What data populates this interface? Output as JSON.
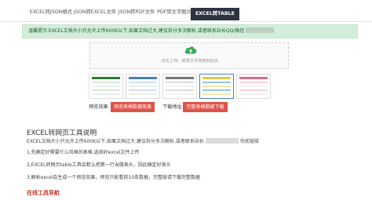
{
  "tabs": [
    {
      "label": "EXCEL转JSON格式",
      "active": false
    },
    {
      "label": "JSON转EXCEL文件",
      "active": false
    },
    {
      "label": "JSON转PDF文件",
      "active": false
    },
    {
      "label": "PDF转文字图片",
      "active": false
    },
    {
      "label": "EXCEL转TABLE",
      "active": true
    }
  ],
  "notice": {
    "text": "温馨提示:EXCEL文档大小只允许上传600K以下,如果文档过大,建议拆分多次解析,或者联系站长QQ/微信"
  },
  "upload": {
    "icon": "cloud-upload-icon",
    "hint": "点击上传，或将文件拖拽到此处"
  },
  "thumbnails": [
    {
      "name": "style-1",
      "header_color": "#2e7d3a",
      "selected": false
    },
    {
      "name": "style-2",
      "header_color": "#4a7fb8",
      "selected": false
    },
    {
      "name": "style-3",
      "header_color": "#777777",
      "selected": false
    },
    {
      "name": "style-4",
      "header_color": "#e3c74a",
      "selected": true
    },
    {
      "name": "style-5",
      "header_color": "#e06a8a",
      "selected": false
    }
  ],
  "preview": {
    "label": "预览效果",
    "button": "预览表格数据效果"
  },
  "download": {
    "label": "下载地址",
    "button": "完整表格数据下载"
  },
  "instructions": {
    "title": "EXCEL转网页工具说明",
    "lines": [
      "EXCEL文档大小只允许上传600K以下,如果文档过大,建议拆分多次解析,或者联系站长",
      "1,先确定好需要什么风格的表格,选择好excel文件上传",
      "2,EXCEL转网页table工具会默认把第一行当做表头，因此确定好表头",
      "3,解析excel会生成一个预览效果，预览只能看前10条数据，完整版请下载完整数据"
    ],
    "line1_suffix": "勿扰链接"
  },
  "footer": {
    "link": "在线工具导航"
  },
  "colors": {
    "active_tab_bg": "#2d3440",
    "notice_bg": "#d4edda",
    "notice_text": "#155724",
    "button_red": "#e0534a",
    "footer_link": "#c0392b",
    "upload_icon": "#3aa757"
  }
}
